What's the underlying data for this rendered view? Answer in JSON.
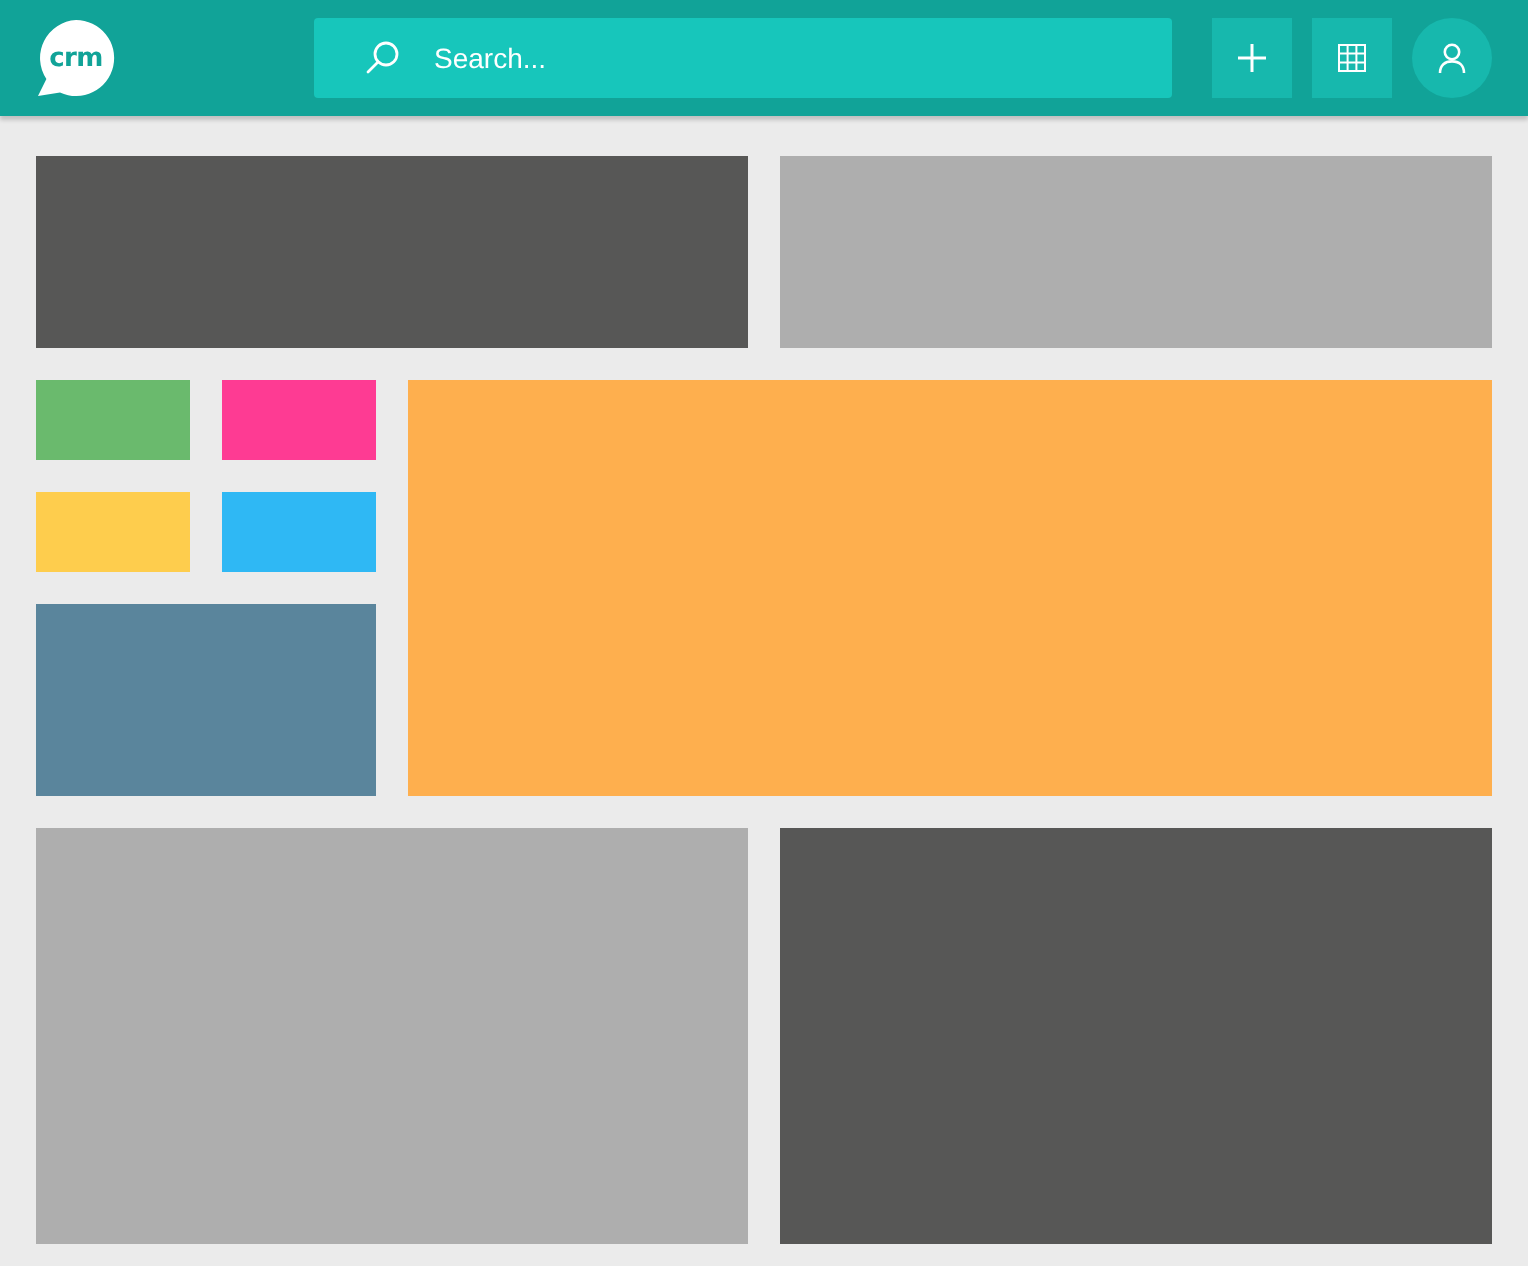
{
  "header": {
    "logo": "crm",
    "search": {
      "placeholder": "Search..."
    }
  },
  "top_row": [
    {
      "color": "#575756"
    },
    {
      "color": "#aeaeae"
    }
  ],
  "small_tiles": [
    {
      "color": "#6aba6d"
    },
    {
      "color": "#fe3b93"
    },
    {
      "color": "#fecd4d"
    },
    {
      "color": "#2fb8f4"
    }
  ],
  "side_tile": {
    "color": "#5a859c"
  },
  "feature_tile": {
    "color": "#feaf4e"
  },
  "bottom_row": [
    {
      "color": "#aeaeae"
    },
    {
      "color": "#575756"
    }
  ]
}
